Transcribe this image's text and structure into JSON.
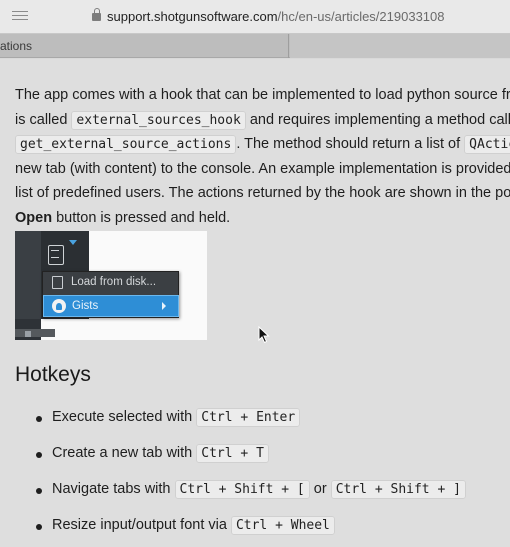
{
  "browser": {
    "url_domain": "support.shotgunsoftware.com",
    "url_path": "/hc/en-us/articles/219033108",
    "tab_label": "ations"
  },
  "article": {
    "paragraph": {
      "l1": "The app comes with a hook that can be implemented to load python source fro",
      "l2_pre": "is called ",
      "l2_code": "external_sources_hook",
      "l2_post": " and requires implementing a method calle",
      "l3_code": "get_external_source_actions",
      "l3_mid": ". The method should return a list of ",
      "l3_code2": "QActic",
      "l4": "new tab (with content) to the console. An example implementation is provided",
      "l5": "list of predefined users. The actions returned by the hook are shown in the pop",
      "l6_bold": "Open",
      "l6_post": " button is pressed and held."
    },
    "screenshot": {
      "menu_item_1": "Load from disk...",
      "menu_item_2": "Gists"
    },
    "hotkeys_heading": "Hotkeys",
    "hotkeys": [
      {
        "text": "Execute selected with ",
        "keys": [
          "Ctrl + Enter"
        ],
        "joiner": ""
      },
      {
        "text": "Create a new tab with ",
        "keys": [
          "Ctrl + T"
        ],
        "joiner": ""
      },
      {
        "text": "Navigate tabs with ",
        "keys": [
          "Ctrl + Shift + [",
          "Ctrl + Shift + ]"
        ],
        "joiner": " or "
      },
      {
        "text": "Resize input/output font via ",
        "keys": [
          "Ctrl + Wheel"
        ],
        "joiner": ""
      }
    ]
  },
  "colors": {
    "page_bg": "#dedede",
    "menu_highlight": "#2e8ed6"
  }
}
